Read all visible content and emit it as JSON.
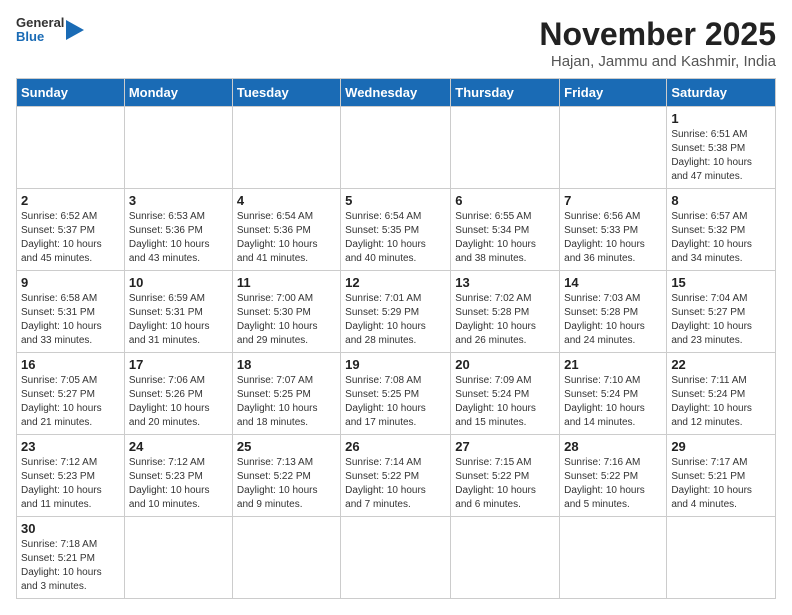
{
  "header": {
    "logo_general": "General",
    "logo_blue": "Blue",
    "title": "November 2025",
    "subtitle": "Hajan, Jammu and Kashmir, India"
  },
  "days_of_week": [
    "Sunday",
    "Monday",
    "Tuesday",
    "Wednesday",
    "Thursday",
    "Friday",
    "Saturday"
  ],
  "weeks": [
    [
      null,
      null,
      null,
      null,
      null,
      null,
      {
        "day": 1,
        "sunrise": "6:51 AM",
        "sunset": "5:38 PM",
        "daylight_hours": 10,
        "daylight_minutes": 47
      }
    ],
    [
      {
        "day": 2,
        "sunrise": "6:52 AM",
        "sunset": "5:37 PM",
        "daylight_hours": 10,
        "daylight_minutes": 45
      },
      {
        "day": 3,
        "sunrise": "6:53 AM",
        "sunset": "5:36 PM",
        "daylight_hours": 10,
        "daylight_minutes": 43
      },
      {
        "day": 4,
        "sunrise": "6:54 AM",
        "sunset": "5:36 PM",
        "daylight_hours": 10,
        "daylight_minutes": 41
      },
      {
        "day": 5,
        "sunrise": "6:54 AM",
        "sunset": "5:35 PM",
        "daylight_hours": 10,
        "daylight_minutes": 40
      },
      {
        "day": 6,
        "sunrise": "6:55 AM",
        "sunset": "5:34 PM",
        "daylight_hours": 10,
        "daylight_minutes": 38
      },
      {
        "day": 7,
        "sunrise": "6:56 AM",
        "sunset": "5:33 PM",
        "daylight_hours": 10,
        "daylight_minutes": 36
      },
      {
        "day": 8,
        "sunrise": "6:57 AM",
        "sunset": "5:32 PM",
        "daylight_hours": 10,
        "daylight_minutes": 34
      }
    ],
    [
      {
        "day": 9,
        "sunrise": "6:58 AM",
        "sunset": "5:31 PM",
        "daylight_hours": 10,
        "daylight_minutes": 33
      },
      {
        "day": 10,
        "sunrise": "6:59 AM",
        "sunset": "5:31 PM",
        "daylight_hours": 10,
        "daylight_minutes": 31
      },
      {
        "day": 11,
        "sunrise": "7:00 AM",
        "sunset": "5:30 PM",
        "daylight_hours": 10,
        "daylight_minutes": 29
      },
      {
        "day": 12,
        "sunrise": "7:01 AM",
        "sunset": "5:29 PM",
        "daylight_hours": 10,
        "daylight_minutes": 28
      },
      {
        "day": 13,
        "sunrise": "7:02 AM",
        "sunset": "5:28 PM",
        "daylight_hours": 10,
        "daylight_minutes": 26
      },
      {
        "day": 14,
        "sunrise": "7:03 AM",
        "sunset": "5:28 PM",
        "daylight_hours": 10,
        "daylight_minutes": 24
      },
      {
        "day": 15,
        "sunrise": "7:04 AM",
        "sunset": "5:27 PM",
        "daylight_hours": 10,
        "daylight_minutes": 23
      }
    ],
    [
      {
        "day": 16,
        "sunrise": "7:05 AM",
        "sunset": "5:27 PM",
        "daylight_hours": 10,
        "daylight_minutes": 21
      },
      {
        "day": 17,
        "sunrise": "7:06 AM",
        "sunset": "5:26 PM",
        "daylight_hours": 10,
        "daylight_minutes": 20
      },
      {
        "day": 18,
        "sunrise": "7:07 AM",
        "sunset": "5:25 PM",
        "daylight_hours": 10,
        "daylight_minutes": 18
      },
      {
        "day": 19,
        "sunrise": "7:08 AM",
        "sunset": "5:25 PM",
        "daylight_hours": 10,
        "daylight_minutes": 17
      },
      {
        "day": 20,
        "sunrise": "7:09 AM",
        "sunset": "5:24 PM",
        "daylight_hours": 10,
        "daylight_minutes": 15
      },
      {
        "day": 21,
        "sunrise": "7:10 AM",
        "sunset": "5:24 PM",
        "daylight_hours": 10,
        "daylight_minutes": 14
      },
      {
        "day": 22,
        "sunrise": "7:11 AM",
        "sunset": "5:24 PM",
        "daylight_hours": 10,
        "daylight_minutes": 12
      }
    ],
    [
      {
        "day": 23,
        "sunrise": "7:12 AM",
        "sunset": "5:23 PM",
        "daylight_hours": 10,
        "daylight_minutes": 11
      },
      {
        "day": 24,
        "sunrise": "7:12 AM",
        "sunset": "5:23 PM",
        "daylight_hours": 10,
        "daylight_minutes": 10
      },
      {
        "day": 25,
        "sunrise": "7:13 AM",
        "sunset": "5:22 PM",
        "daylight_hours": 10,
        "daylight_minutes": 9
      },
      {
        "day": 26,
        "sunrise": "7:14 AM",
        "sunset": "5:22 PM",
        "daylight_hours": 10,
        "daylight_minutes": 7
      },
      {
        "day": 27,
        "sunrise": "7:15 AM",
        "sunset": "5:22 PM",
        "daylight_hours": 10,
        "daylight_minutes": 6
      },
      {
        "day": 28,
        "sunrise": "7:16 AM",
        "sunset": "5:22 PM",
        "daylight_hours": 10,
        "daylight_minutes": 5
      },
      {
        "day": 29,
        "sunrise": "7:17 AM",
        "sunset": "5:21 PM",
        "daylight_hours": 10,
        "daylight_minutes": 4
      }
    ],
    [
      {
        "day": 30,
        "sunrise": "7:18 AM",
        "sunset": "5:21 PM",
        "daylight_hours": 10,
        "daylight_minutes": 3
      },
      null,
      null,
      null,
      null,
      null,
      null
    ]
  ]
}
